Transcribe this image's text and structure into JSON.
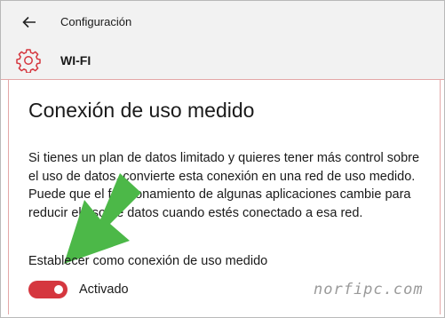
{
  "window": {
    "app_title": "Configuración"
  },
  "header": {
    "page_title": "WI-FI",
    "icon": "gear-icon",
    "accent_color": "#d5373f"
  },
  "main": {
    "section_title": "Conexión de uso medido",
    "description": "Si tienes un plan de datos limitado y quieres tener más control sobre el uso de datos, convierte esta conexión en una red de uso medido. Puede que el funcionamiento de algunas aplicaciones cambie para reducir el uso de datos cuando estés conectado a esa red.",
    "setting": {
      "label": "Establecer como conexión de uso medido",
      "state_label": "Activado",
      "enabled": true,
      "toggle_color": "#d5373f"
    }
  },
  "overlay": {
    "arrow_color": "#4cb848",
    "watermark": "norfipc.com"
  }
}
